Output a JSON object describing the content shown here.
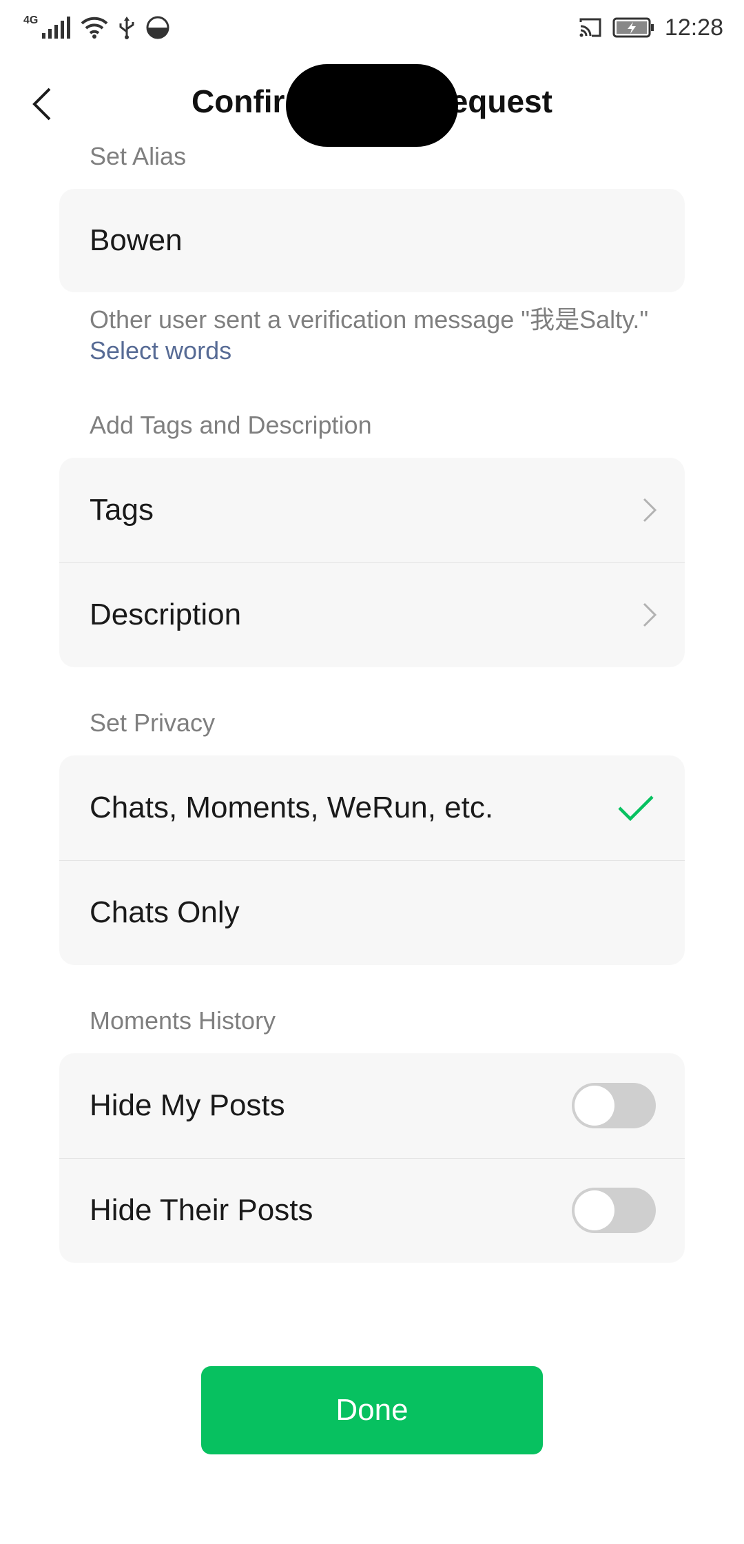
{
  "status_bar": {
    "network": "4G",
    "time": "12:28"
  },
  "nav": {
    "title": "Confirm Friend Request",
    "back_icon": "chevron-left-icon"
  },
  "alias": {
    "label": "Set Alias",
    "value": "Bowen"
  },
  "verification": {
    "message": "Other user sent a verification message \"我是Salty.\"",
    "link": "Select words"
  },
  "tags_section": {
    "label": "Add Tags and Description",
    "items": [
      {
        "label": "Tags"
      },
      {
        "label": "Description"
      }
    ]
  },
  "privacy": {
    "label": "Set Privacy",
    "options": [
      {
        "label": "Chats, Moments, WeRun, etc.",
        "selected": true
      },
      {
        "label": "Chats Only",
        "selected": false
      }
    ]
  },
  "moments": {
    "label": "Moments History",
    "toggles": [
      {
        "label": "Hide My Posts",
        "on": false
      },
      {
        "label": "Hide Their Posts",
        "on": false
      }
    ]
  },
  "done_label": "Done",
  "colors": {
    "accent": "#07c160",
    "link": "#576b95",
    "card_bg": "#f7f7f7"
  }
}
